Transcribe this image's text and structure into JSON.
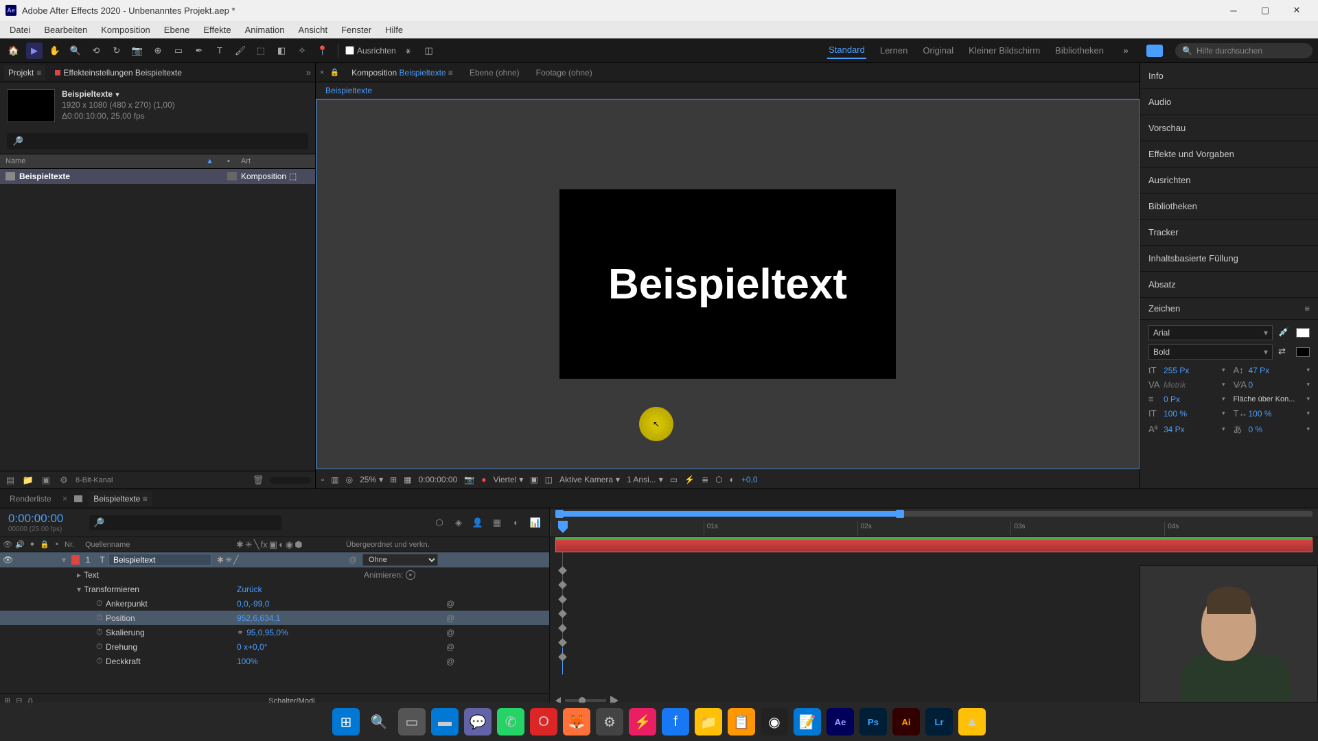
{
  "titlebar": {
    "title": "Adobe After Effects 2020 - Unbenanntes Projekt.aep *"
  },
  "menu": [
    "Datei",
    "Bearbeiten",
    "Komposition",
    "Ebene",
    "Effekte",
    "Animation",
    "Ansicht",
    "Fenster",
    "Hilfe"
  ],
  "toolbar": {
    "align_label": "Ausrichten",
    "search_placeholder": "Hilfe durchsuchen"
  },
  "workspaces": {
    "items": [
      "Standard",
      "Lernen",
      "Original",
      "Kleiner Bildschirm",
      "Bibliotheken"
    ],
    "active": "Standard"
  },
  "project": {
    "tab": "Projekt",
    "fx_tab": "Effekteinstellungen Beispieltexte",
    "comp_name": "Beispieltexte",
    "dimensions": "1920 x 1080 (480 x 270) (1,00)",
    "duration": "Δ0:00:10:00, 25,00 fps",
    "cols": {
      "name": "Name",
      "art": "Art"
    },
    "item": {
      "name": "Beispieltexte",
      "type": "Komposition"
    },
    "bit": "8-Bit-Kanal"
  },
  "comp_panel": {
    "comp_label": "Komposition",
    "comp_name": "Beispieltexte",
    "layer_tab": "Ebene  (ohne)",
    "footage_tab": "Footage  (ohne)",
    "breadcrumb": "Beispieltexte",
    "canvas_text": "Beispieltext",
    "footer": {
      "zoom": "25%",
      "timecode": "0:00:00:00",
      "res": "Viertel",
      "camera": "Aktive Kamera",
      "views": "1 Ansi...",
      "exposure": "+0,0"
    }
  },
  "right_panels": [
    "Info",
    "Audio",
    "Vorschau",
    "Effekte und Vorgaben",
    "Ausrichten",
    "Bibliotheken",
    "Tracker",
    "Inhaltsbasierte Füllung",
    "Absatz"
  ],
  "char": {
    "title": "Zeichen",
    "font": "Arial",
    "style": "Bold",
    "size": "255 Px",
    "leading": "47 Px",
    "kerning": "Metrik",
    "tracking": "0",
    "stroke": "0 Px",
    "stroke_mode": "Fläche über Kon...",
    "hscale": "100 %",
    "vscale": "100 %",
    "baseline": "34 Px",
    "tsume": "0 %"
  },
  "timeline": {
    "render_tab": "Renderliste",
    "comp_tab": "Beispieltexte",
    "timecode": "0:00:00:00",
    "frames": "00000 (25.00 fps)",
    "cols": {
      "nr": "Nr.",
      "name": "Quellenname",
      "parent": "Übergeordnet und verkn."
    },
    "layer": {
      "num": "1",
      "name": "Beispieltext",
      "parent": "Ohne"
    },
    "props": {
      "text": "Text",
      "animate": "Animieren:",
      "transform": "Transformieren",
      "reset": "Zurück",
      "anchor": "Ankerpunkt",
      "anchor_val": "0,0,-99,0",
      "position": "Position",
      "position_val": "952,6,634,1",
      "scale": "Skalierung",
      "scale_val": "95,0,95,0%",
      "rotation": "Drehung",
      "rotation_val": "0 x+0,0°",
      "opacity": "Deckkraft",
      "opacity_val": "100%"
    },
    "footer": "Schalter/Modi",
    "ticks": [
      "",
      "01s",
      "02s",
      "03s",
      "04s"
    ]
  },
  "taskbar_colors": [
    "#0078d4",
    "#333",
    "#555",
    "#0078d4",
    "#8b5cf6",
    "#25d366",
    "#dc2626",
    "#ff7139",
    "#666",
    "#e91e63",
    "#1877f2",
    "#ffc107",
    "#ff9800",
    "#333",
    "#0078d4",
    "#00005b",
    "#001e36",
    "#330000",
    "#001e36",
    "#ffc107"
  ]
}
